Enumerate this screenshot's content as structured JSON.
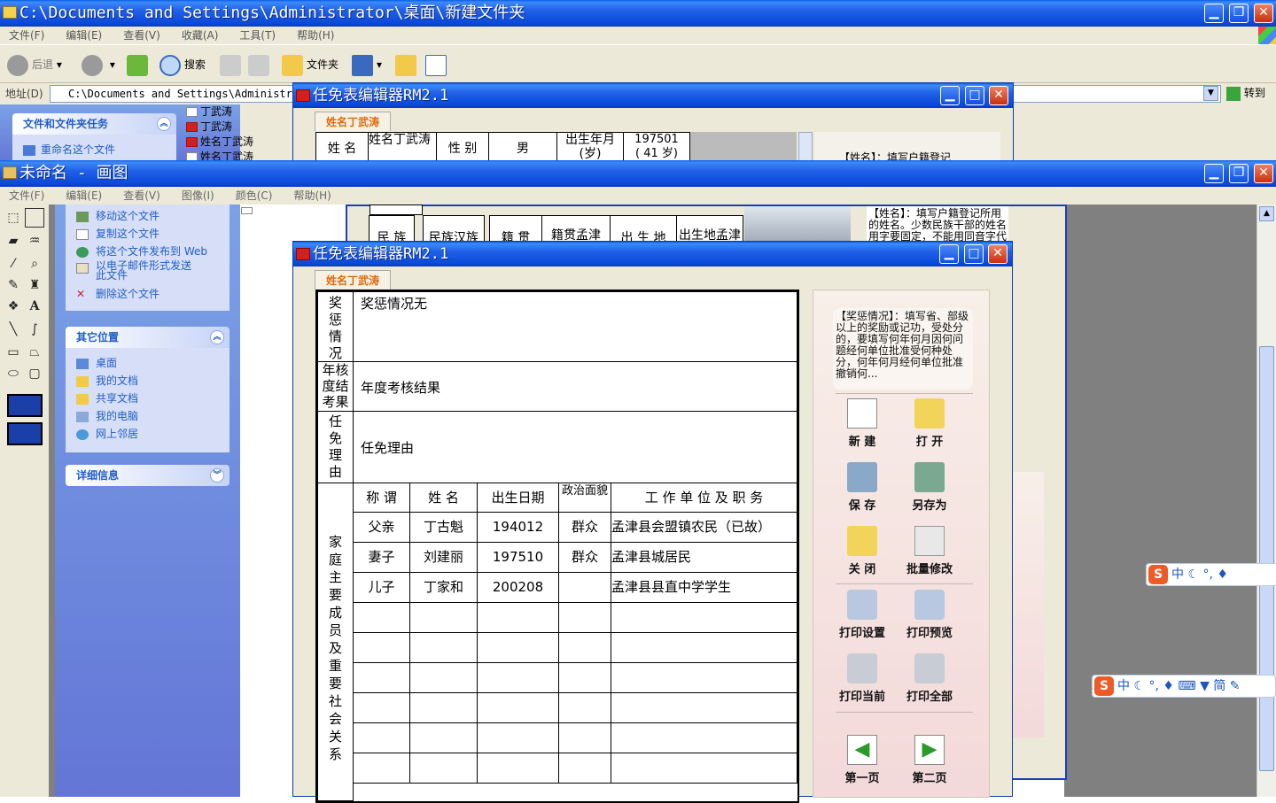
{
  "explorer": {
    "title": "C:\\Documents and Settings\\Administrator\\桌面\\新建文件夹",
    "menu": [
      "文件(F)",
      "编辑(E)",
      "查看(V)",
      "收藏(A)",
      "工具(T)",
      "帮助(H)"
    ],
    "toolbar": {
      "back": "后退",
      "search": "搜索",
      "folders": "文件夹"
    },
    "address_label": "地址(D)",
    "address_value": "C:\\Documents and Settings\\Administrator\\桌面\\新建文件夹",
    "go_label": "转到",
    "file_tasks_title": "文件和文件夹任务",
    "rename_task": "重命名这个文件",
    "files": [
      "丁武涛",
      "丁武涛",
      "姓名丁武涛",
      "姓名丁武涛",
      "姓名丁武涛"
    ]
  },
  "paint": {
    "title": "未命名 - 画图",
    "menu": [
      "文件(F)",
      "编辑(E)",
      "查看(V)",
      "图像(I)",
      "颜色(C)",
      "帮助(H)"
    ],
    "tasks": [
      "移动这个文件",
      "复制这个文件",
      "将这个文件发布到 Web",
      "以电子邮件形式发送此文件",
      "删除这个文件"
    ],
    "other_places_title": "其它位置",
    "other_places": [
      "桌面",
      "我的文档",
      "共享文档",
      "我的电脑",
      "网上邻居"
    ],
    "details_title": "详细信息"
  },
  "back_editor": {
    "title": "任免表编辑器RM2.1",
    "tab": "姓名丁武涛",
    "row1": [
      "姓 名",
      "姓名丁武涛",
      "性 别",
      "男",
      "出生年月(岁)",
      "197501"
    ],
    "age": "( 41 岁)",
    "row2": [
      "民 族",
      "民族汉族",
      "籍 贯",
      "籍贯孟津",
      "出 生 地",
      "出生地孟津"
    ],
    "help_line1": "【姓名】：填写户籍登记",
    "help_line2": "【姓名】：填写户籍登记所用的姓名。少数民族干部的姓名用字要固定，不能用同音字代替，最多能..."
  },
  "editor": {
    "title": "任免表编辑器RM2.1",
    "tab": "姓名丁武涛",
    "rewards_label": "奖惩情况",
    "rewards_value": "奖惩情况无",
    "assessment_label": "年核度结考果",
    "assessment_value": "年度考核结果",
    "reason_label": "任免理由",
    "reason_value": "任免理由",
    "family_label": "家庭主要成员及重要社会关系",
    "family_headers": [
      "称 谓",
      "姓 名",
      "出生日期",
      "政治面貌",
      "工 作 单 位 及 职 务"
    ],
    "family_rows": [
      [
        "父亲",
        "丁古魁",
        "194012",
        "群众",
        "孟津县会盟镇农民（已故）"
      ],
      [
        "妻子",
        "刘建丽",
        "197510",
        "群众",
        "孟津县城居民"
      ],
      [
        "儿子",
        "丁家和",
        "200208",
        "",
        "孟津县县直中学学生"
      ]
    ],
    "help_text": "【奖惩情况】：填写省、部级以上的奖励或记功，受处分的，要填写何年何月因何问题经何单位批准受何种处分，何年何月经何单位批准撤销何...",
    "buttons": {
      "new": "新 建",
      "open": "打 开",
      "save": "保 存",
      "save_as": "另存为",
      "close": "关 闭",
      "batch_edit": "批量修改",
      "print_setup": "打印设置",
      "print_preview": "打印预览",
      "print_current": "打印当前",
      "print_all": "打印全部",
      "page1": "第一页",
      "page2": "第二页"
    }
  },
  "ime": {
    "zh": "中",
    "simplified": "简"
  }
}
